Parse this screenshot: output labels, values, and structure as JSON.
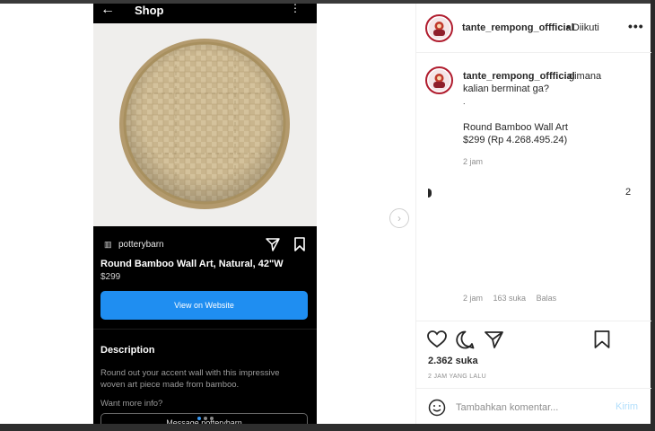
{
  "phone": {
    "back_icon": "arrow-left-icon",
    "title": "Shop",
    "kebab_icon": "more-vertical-icon",
    "shop_name": "potterybarn",
    "product_title": "Round Bamboo Wall Art, Natural, 42\"W",
    "product_price": "$299",
    "view_button": "View on Website",
    "description_heading": "Description",
    "description_text": "Round out your accent wall with this impressive woven art piece made from bamboo.",
    "more_info": "Want more info?",
    "message_button": "Message potterybarn"
  },
  "post": {
    "username": "tante_rempong_offficial",
    "follow_status": "• Diikuti",
    "caption_text_line1": "gimana",
    "caption_text_line2": "kalian berminat ga?",
    "caption_dot": ".",
    "caption_product": "Round Bamboo Wall Art",
    "caption_price": "$299 (Rp 4.268.495.24)",
    "caption_time": "2 jam",
    "comment_count": "2",
    "comment_time": "2 jam",
    "comment_likes": "163 suka",
    "comment_reply": "Balas",
    "likes": "2.362 suka",
    "posted_ago": "2 JAM YANG LALU",
    "comment_placeholder": "Tambahkan komentar...",
    "send_label": "Kirim"
  },
  "colors": {
    "accent": "#1f8ef1",
    "avatar_ring": "#b01c2e",
    "send_disabled": "#b2dffc",
    "text_primary": "#262626",
    "text_secondary": "#8e8e8e"
  }
}
